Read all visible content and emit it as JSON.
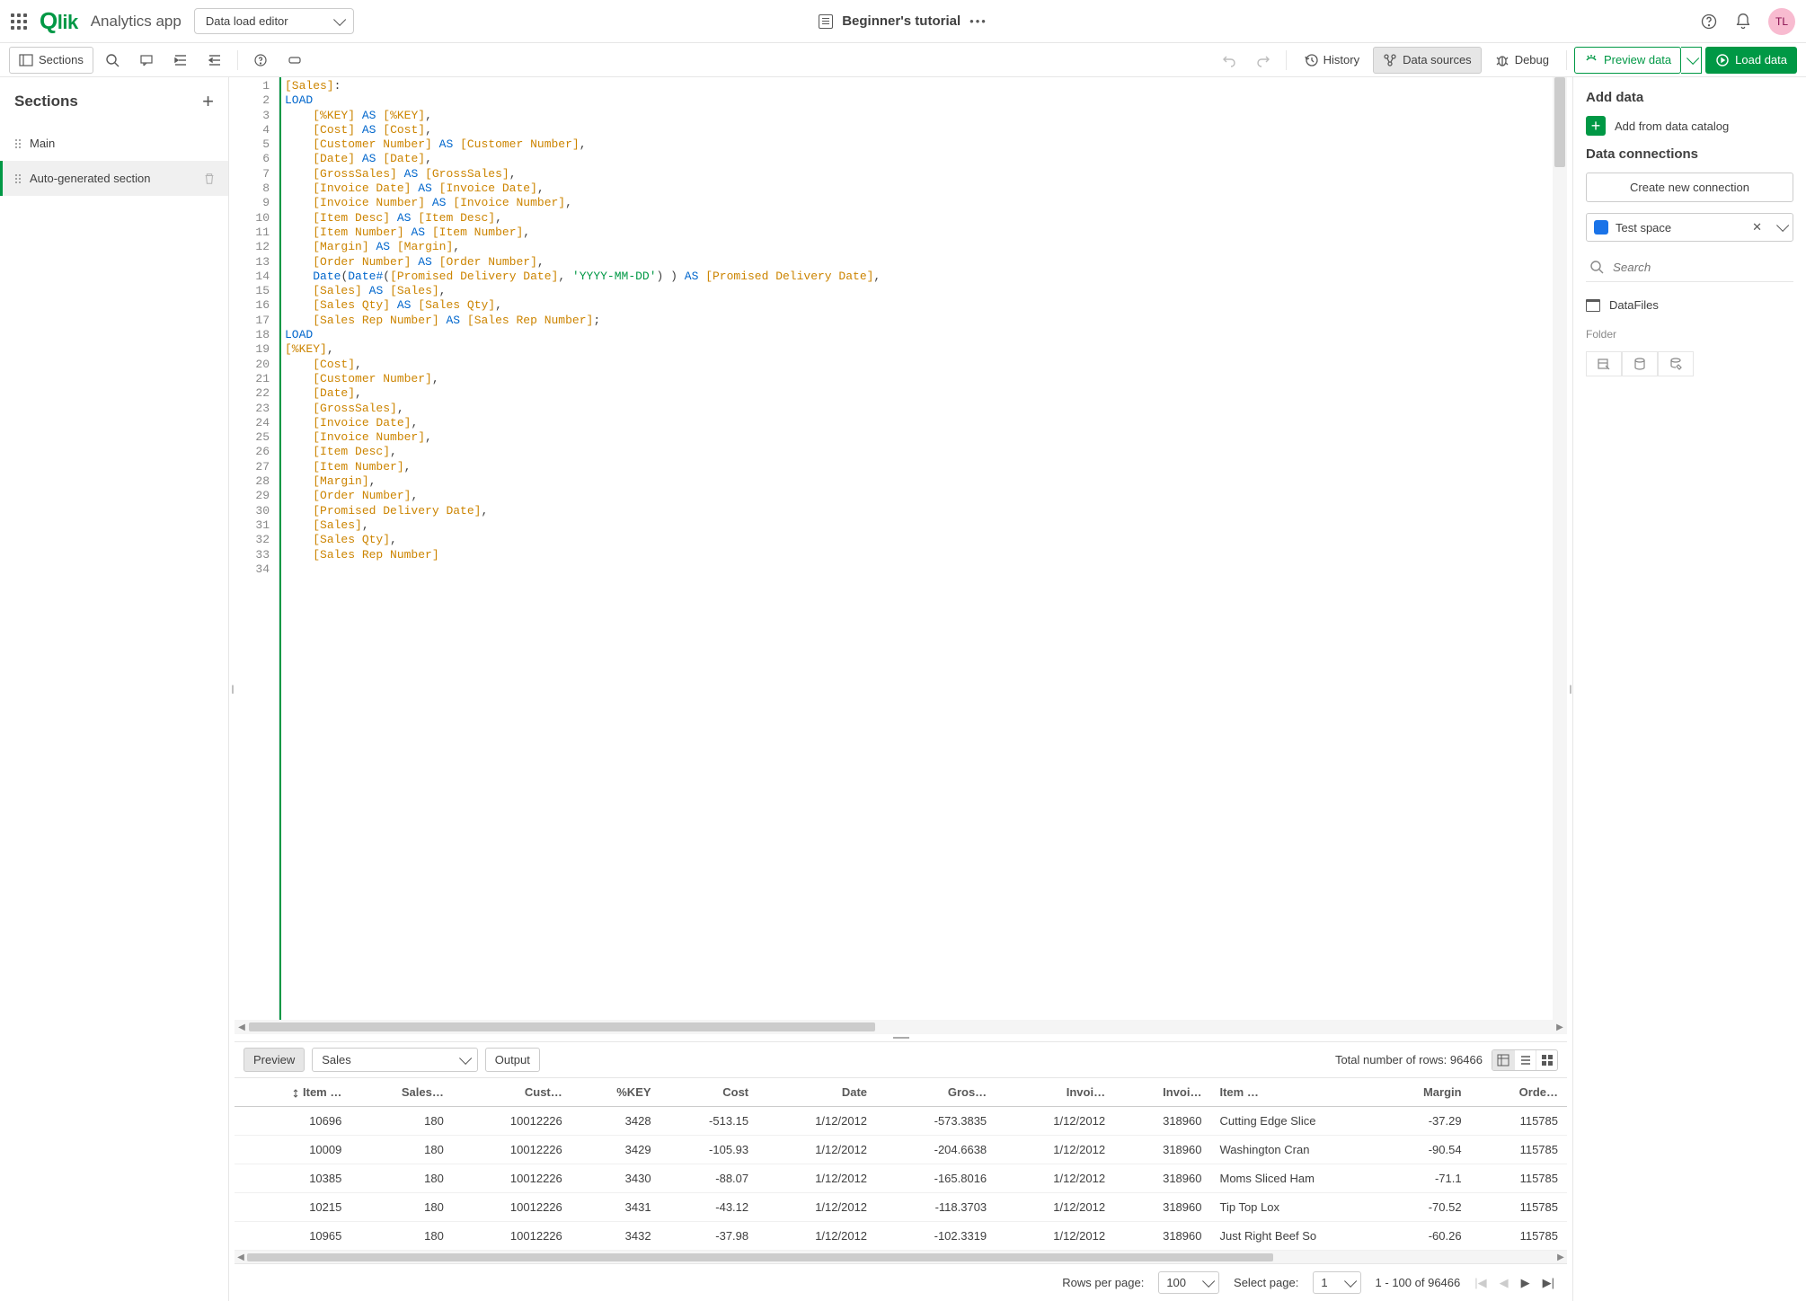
{
  "header": {
    "appName": "Analytics app",
    "logo": "Qlik",
    "modeDropdown": "Data load editor",
    "title": "Beginner's tutorial",
    "avatar": "TL"
  },
  "toolbar": {
    "sections": "Sections",
    "history": "History",
    "dataSources": "Data sources",
    "debug": "Debug",
    "previewData": "Preview data",
    "loadData": "Load data"
  },
  "sections": {
    "title": "Sections",
    "items": [
      "Main",
      "Auto-generated section"
    ],
    "activeIndex": 1
  },
  "code": {
    "lines": [
      [
        {
          "c": "br",
          "t": "[Sales]"
        },
        {
          "c": "op",
          "t": ":"
        }
      ],
      [
        {
          "c": "kw",
          "t": "LOAD"
        }
      ],
      [
        {
          "c": "",
          "t": "    "
        },
        {
          "c": "br",
          "t": "[%KEY]"
        },
        {
          "c": "",
          "t": " "
        },
        {
          "c": "kw",
          "t": "AS"
        },
        {
          "c": "",
          "t": " "
        },
        {
          "c": "br",
          "t": "[%KEY]"
        },
        {
          "c": "op",
          "t": ","
        }
      ],
      [
        {
          "c": "",
          "t": "    "
        },
        {
          "c": "br",
          "t": "[Cost]"
        },
        {
          "c": "",
          "t": " "
        },
        {
          "c": "kw",
          "t": "AS"
        },
        {
          "c": "",
          "t": " "
        },
        {
          "c": "br",
          "t": "[Cost]"
        },
        {
          "c": "op",
          "t": ","
        }
      ],
      [
        {
          "c": "",
          "t": "    "
        },
        {
          "c": "br",
          "t": "[Customer Number]"
        },
        {
          "c": "",
          "t": " "
        },
        {
          "c": "kw",
          "t": "AS"
        },
        {
          "c": "",
          "t": " "
        },
        {
          "c": "br",
          "t": "[Customer Number]"
        },
        {
          "c": "op",
          "t": ","
        }
      ],
      [
        {
          "c": "",
          "t": "    "
        },
        {
          "c": "br",
          "t": "[Date]"
        },
        {
          "c": "",
          "t": " "
        },
        {
          "c": "kw",
          "t": "AS"
        },
        {
          "c": "",
          "t": " "
        },
        {
          "c": "br",
          "t": "[Date]"
        },
        {
          "c": "op",
          "t": ","
        }
      ],
      [
        {
          "c": "",
          "t": "    "
        },
        {
          "c": "br",
          "t": "[GrossSales]"
        },
        {
          "c": "",
          "t": " "
        },
        {
          "c": "kw",
          "t": "AS"
        },
        {
          "c": "",
          "t": " "
        },
        {
          "c": "br",
          "t": "[GrossSales]"
        },
        {
          "c": "op",
          "t": ","
        }
      ],
      [
        {
          "c": "",
          "t": "    "
        },
        {
          "c": "br",
          "t": "[Invoice Date]"
        },
        {
          "c": "",
          "t": " "
        },
        {
          "c": "kw",
          "t": "AS"
        },
        {
          "c": "",
          "t": " "
        },
        {
          "c": "br",
          "t": "[Invoice Date]"
        },
        {
          "c": "op",
          "t": ","
        }
      ],
      [
        {
          "c": "",
          "t": "    "
        },
        {
          "c": "br",
          "t": "[Invoice Number]"
        },
        {
          "c": "",
          "t": " "
        },
        {
          "c": "kw",
          "t": "AS"
        },
        {
          "c": "",
          "t": " "
        },
        {
          "c": "br",
          "t": "[Invoice Number]"
        },
        {
          "c": "op",
          "t": ","
        }
      ],
      [
        {
          "c": "",
          "t": "    "
        },
        {
          "c": "br",
          "t": "[Item Desc]"
        },
        {
          "c": "",
          "t": " "
        },
        {
          "c": "kw",
          "t": "AS"
        },
        {
          "c": "",
          "t": " "
        },
        {
          "c": "br",
          "t": "[Item Desc]"
        },
        {
          "c": "op",
          "t": ","
        }
      ],
      [
        {
          "c": "",
          "t": "    "
        },
        {
          "c": "br",
          "t": "[Item Number]"
        },
        {
          "c": "",
          "t": " "
        },
        {
          "c": "kw",
          "t": "AS"
        },
        {
          "c": "",
          "t": " "
        },
        {
          "c": "br",
          "t": "[Item Number]"
        },
        {
          "c": "op",
          "t": ","
        }
      ],
      [
        {
          "c": "",
          "t": "    "
        },
        {
          "c": "br",
          "t": "[Margin]"
        },
        {
          "c": "",
          "t": " "
        },
        {
          "c": "kw",
          "t": "AS"
        },
        {
          "c": "",
          "t": " "
        },
        {
          "c": "br",
          "t": "[Margin]"
        },
        {
          "c": "op",
          "t": ","
        }
      ],
      [
        {
          "c": "",
          "t": "    "
        },
        {
          "c": "br",
          "t": "[Order Number]"
        },
        {
          "c": "",
          "t": " "
        },
        {
          "c": "kw",
          "t": "AS"
        },
        {
          "c": "",
          "t": " "
        },
        {
          "c": "br",
          "t": "[Order Number]"
        },
        {
          "c": "op",
          "t": ","
        }
      ],
      [
        {
          "c": "",
          "t": "    "
        },
        {
          "c": "fn",
          "t": "Date"
        },
        {
          "c": "op",
          "t": "("
        },
        {
          "c": "fn",
          "t": "Date#"
        },
        {
          "c": "op",
          "t": "("
        },
        {
          "c": "br",
          "t": "[Promised Delivery Date]"
        },
        {
          "c": "op",
          "t": ", "
        },
        {
          "c": "str",
          "t": "'YYYY-MM-DD'"
        },
        {
          "c": "op",
          "t": ") ) "
        },
        {
          "c": "kw",
          "t": "AS"
        },
        {
          "c": "",
          "t": " "
        },
        {
          "c": "br",
          "t": "[Promised Delivery Date]"
        },
        {
          "c": "op",
          "t": ","
        }
      ],
      [
        {
          "c": "",
          "t": "    "
        },
        {
          "c": "br",
          "t": "[Sales]"
        },
        {
          "c": "",
          "t": " "
        },
        {
          "c": "kw",
          "t": "AS"
        },
        {
          "c": "",
          "t": " "
        },
        {
          "c": "br",
          "t": "[Sales]"
        },
        {
          "c": "op",
          "t": ","
        }
      ],
      [
        {
          "c": "",
          "t": "    "
        },
        {
          "c": "br",
          "t": "[Sales Qty]"
        },
        {
          "c": "",
          "t": " "
        },
        {
          "c": "kw",
          "t": "AS"
        },
        {
          "c": "",
          "t": " "
        },
        {
          "c": "br",
          "t": "[Sales Qty]"
        },
        {
          "c": "op",
          "t": ","
        }
      ],
      [
        {
          "c": "",
          "t": "    "
        },
        {
          "c": "br",
          "t": "[Sales Rep Number]"
        },
        {
          "c": "",
          "t": " "
        },
        {
          "c": "kw",
          "t": "AS"
        },
        {
          "c": "",
          "t": " "
        },
        {
          "c": "br",
          "t": "[Sales Rep Number]"
        },
        {
          "c": "op",
          "t": ";"
        }
      ],
      [
        {
          "c": "kw",
          "t": "LOAD"
        }
      ],
      [
        {
          "c": "br",
          "t": "[%KEY]"
        },
        {
          "c": "op",
          "t": ","
        }
      ],
      [
        {
          "c": "",
          "t": "    "
        },
        {
          "c": "br",
          "t": "[Cost]"
        },
        {
          "c": "op",
          "t": ","
        }
      ],
      [
        {
          "c": "",
          "t": "    "
        },
        {
          "c": "br",
          "t": "[Customer Number]"
        },
        {
          "c": "op",
          "t": ","
        }
      ],
      [
        {
          "c": "",
          "t": "    "
        },
        {
          "c": "br",
          "t": "[Date]"
        },
        {
          "c": "op",
          "t": ","
        }
      ],
      [
        {
          "c": "",
          "t": "    "
        },
        {
          "c": "br",
          "t": "[GrossSales]"
        },
        {
          "c": "op",
          "t": ","
        }
      ],
      [
        {
          "c": "",
          "t": "    "
        },
        {
          "c": "br",
          "t": "[Invoice Date]"
        },
        {
          "c": "op",
          "t": ","
        }
      ],
      [
        {
          "c": "",
          "t": "    "
        },
        {
          "c": "br",
          "t": "[Invoice Number]"
        },
        {
          "c": "op",
          "t": ","
        }
      ],
      [
        {
          "c": "",
          "t": "    "
        },
        {
          "c": "br",
          "t": "[Item Desc]"
        },
        {
          "c": "op",
          "t": ","
        }
      ],
      [
        {
          "c": "",
          "t": "    "
        },
        {
          "c": "br",
          "t": "[Item Number]"
        },
        {
          "c": "op",
          "t": ","
        }
      ],
      [
        {
          "c": "",
          "t": "    "
        },
        {
          "c": "br",
          "t": "[Margin]"
        },
        {
          "c": "op",
          "t": ","
        }
      ],
      [
        {
          "c": "",
          "t": "    "
        },
        {
          "c": "br",
          "t": "[Order Number]"
        },
        {
          "c": "op",
          "t": ","
        }
      ],
      [
        {
          "c": "",
          "t": "    "
        },
        {
          "c": "br",
          "t": "[Promised Delivery Date]"
        },
        {
          "c": "op",
          "t": ","
        }
      ],
      [
        {
          "c": "",
          "t": "    "
        },
        {
          "c": "br",
          "t": "[Sales]"
        },
        {
          "c": "op",
          "t": ","
        }
      ],
      [
        {
          "c": "",
          "t": "    "
        },
        {
          "c": "br",
          "t": "[Sales Qty]"
        },
        {
          "c": "op",
          "t": ","
        }
      ],
      [
        {
          "c": "",
          "t": "    "
        },
        {
          "c": "br",
          "t": "[Sales Rep Number]"
        }
      ],
      [
        {
          "c": "",
          "t": ""
        }
      ]
    ]
  },
  "rightPanel": {
    "addData": "Add data",
    "addFromCatalog": "Add from data catalog",
    "dataConnections": "Data connections",
    "createNew": "Create new connection",
    "space": "Test space",
    "searchPh": "Search",
    "dataFiles": "DataFiles",
    "folder": "Folder"
  },
  "preview": {
    "previewTab": "Preview",
    "outputTab": "Output",
    "tableDropdown": "Sales",
    "totalRows": "Total number of rows: 96466",
    "columns": [
      "Item …",
      "Sales…",
      "Cust…",
      "%KEY",
      "Cost",
      "Date",
      "Gros…",
      "Invoi…",
      "Invoi…",
      "Item …",
      "Margin",
      "Orde…"
    ],
    "rows": [
      [
        "10696",
        "180",
        "10012226",
        "3428",
        "-513.15",
        "1/12/2012",
        "-573.3835",
        "1/12/2012",
        "318960",
        "Cutting Edge Slice",
        "-37.29",
        "115785"
      ],
      [
        "10009",
        "180",
        "10012226",
        "3429",
        "-105.93",
        "1/12/2012",
        "-204.6638",
        "1/12/2012",
        "318960",
        "Washington Cran",
        "-90.54",
        "115785"
      ],
      [
        "10385",
        "180",
        "10012226",
        "3430",
        "-88.07",
        "1/12/2012",
        "-165.8016",
        "1/12/2012",
        "318960",
        "Moms Sliced Ham",
        "-71.1",
        "115785"
      ],
      [
        "10215",
        "180",
        "10012226",
        "3431",
        "-43.12",
        "1/12/2012",
        "-118.3703",
        "1/12/2012",
        "318960",
        "Tip Top Lox",
        "-70.52",
        "115785"
      ],
      [
        "10965",
        "180",
        "10012226",
        "3432",
        "-37.98",
        "1/12/2012",
        "-102.3319",
        "1/12/2012",
        "318960",
        "Just Right Beef So",
        "-60.26",
        "115785"
      ]
    ]
  },
  "pager": {
    "rowsPerPage": "Rows per page:",
    "rowsVal": "100",
    "selectPage": "Select page:",
    "pageVal": "1",
    "range": "1 - 100 of 96466"
  }
}
